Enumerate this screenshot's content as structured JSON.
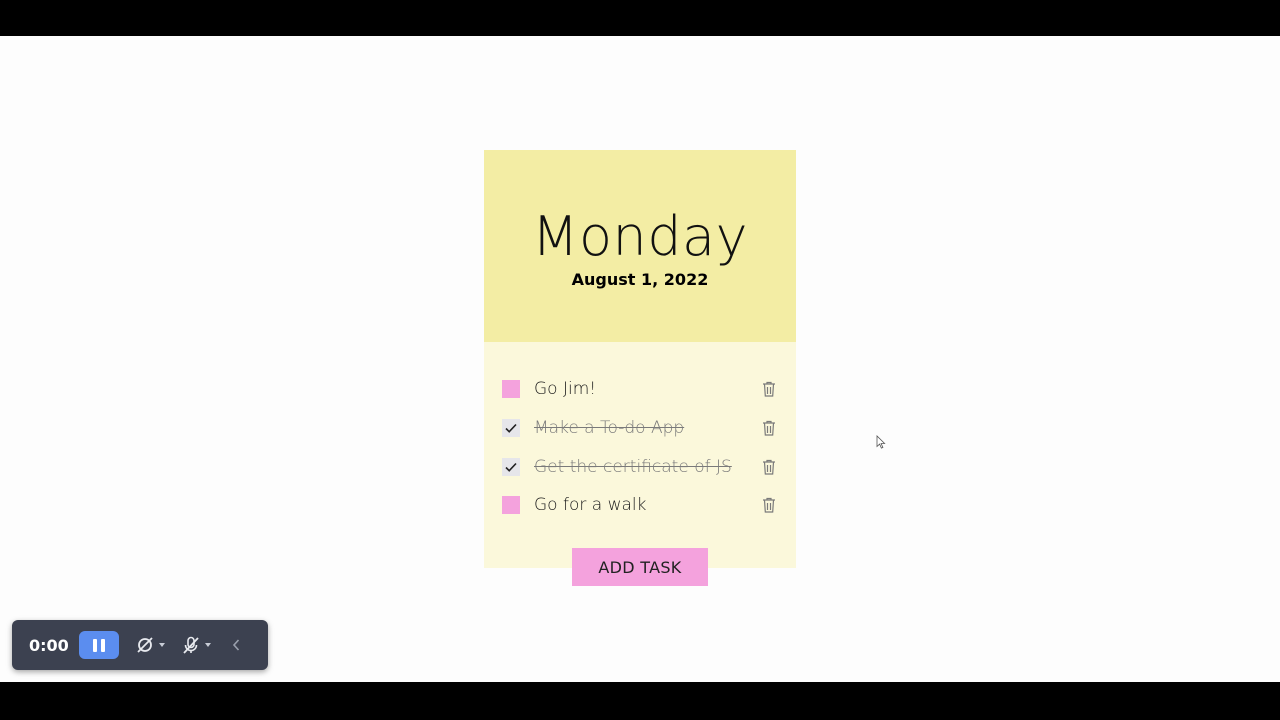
{
  "header": {
    "day": "Monday",
    "date": "August 1, 2022"
  },
  "tasks": [
    {
      "label": "Go Jim!",
      "done": false
    },
    {
      "label": "Make a To-do App",
      "done": true
    },
    {
      "label": "Get the certificate of JS",
      "done": true
    },
    {
      "label": "Go for a walk",
      "done": false
    }
  ],
  "add_button_label": "ADD TASK",
  "recorder": {
    "time": "0:00"
  },
  "colors": {
    "header_bg": "#f3eda4",
    "body_bg": "#fbf8db",
    "accent_pink": "#f4a2dd",
    "checked_box": "#e6e6ea",
    "recorder_bg": "#3c4150",
    "pause_blue": "#5b8def"
  },
  "icons": {
    "task_delete": "trash-icon",
    "task_check": "checkmark-icon",
    "recorder_pause": "pause-icon",
    "recorder_camera": "camera-off-icon",
    "recorder_mic": "mic-off-icon",
    "recorder_collapse": "chevron-left-icon"
  }
}
